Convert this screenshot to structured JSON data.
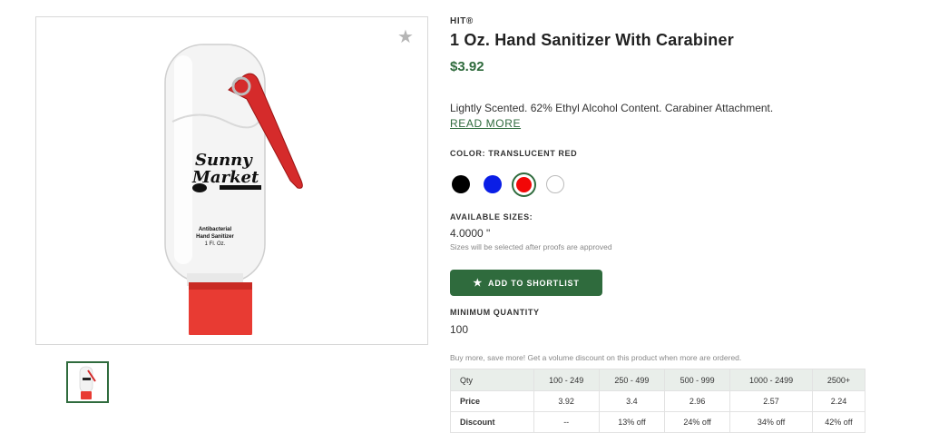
{
  "product": {
    "brand": "HIT®",
    "title": "1 Oz. Hand Sanitizer With Carabiner",
    "price": "$3.92",
    "description": "Lightly Scented. 62% Ethyl Alcohol Content. Carabiner Attachment.",
    "read_more": "READ MORE"
  },
  "image": {
    "logo_line1": "Sunny",
    "logo_line2": "Market",
    "label_line1": "Antibacterial",
    "label_line2": "Hand Sanitizer",
    "label_line3": "1 Fl. Oz."
  },
  "color": {
    "label": "COLOR: TRANSLUCENT RED",
    "swatches": [
      {
        "name": "black",
        "hex": "#000000"
      },
      {
        "name": "blue",
        "hex": "#0a1ee6"
      },
      {
        "name": "red",
        "hex": "#f20707",
        "selected": true
      },
      {
        "name": "white",
        "hex": "#ffffff"
      }
    ]
  },
  "sizes": {
    "label": "AVAILABLE SIZES:",
    "value": "4.0000 \"",
    "note": "Sizes will be selected after proofs are approved"
  },
  "shortlist_button": "ADD TO SHORTLIST",
  "minimum": {
    "label": "MINIMUM QUANTITY",
    "value": "100"
  },
  "volume_note": "Buy more, save more! Get a volume discount on this product when more are ordered.",
  "pricing": {
    "headers": [
      "Qty",
      "100 - 249",
      "250 - 499",
      "500 - 999",
      "1000 - 2499",
      "2500+"
    ],
    "rows": [
      [
        "Price",
        "3.92",
        "3.4",
        "2.96",
        "2.57",
        "2.24"
      ],
      [
        "Discount",
        "--",
        "13% off",
        "24% off",
        "34% off",
        "42% off"
      ]
    ]
  },
  "colors": {
    "accent": "#2f6b3d"
  }
}
